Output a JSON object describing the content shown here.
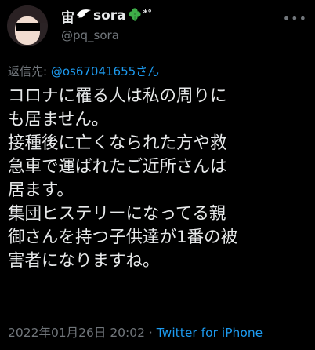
{
  "author": {
    "display_name": "宙",
    "display_name_suffix": "sora",
    "emoji_after": "*°",
    "handle": "@pq_sora"
  },
  "reply": {
    "prefix": "返信先: ",
    "mention": "@os67041655さん"
  },
  "tweet": {
    "lines": [
      "コロナに罹る人は私の周りに",
      "も居ません。",
      "接種後に亡くなられた方や救",
      "急車で運ばれたご近所さんは",
      "居ます。",
      "集団ヒステリーになってる親",
      "御さんを持つ子供達が1番の被",
      "害者になりますね。"
    ]
  },
  "meta": {
    "timestamp": "2022年01月26日 20:02",
    "separator": " · ",
    "source": "Twitter for iPhone"
  },
  "colors": {
    "background": "#000000",
    "text": "#e7e9ea",
    "secondary": "#71767b",
    "link": "#1d9bf0"
  },
  "icons": [
    "dove-icon",
    "clover-icon",
    "more-icon"
  ]
}
